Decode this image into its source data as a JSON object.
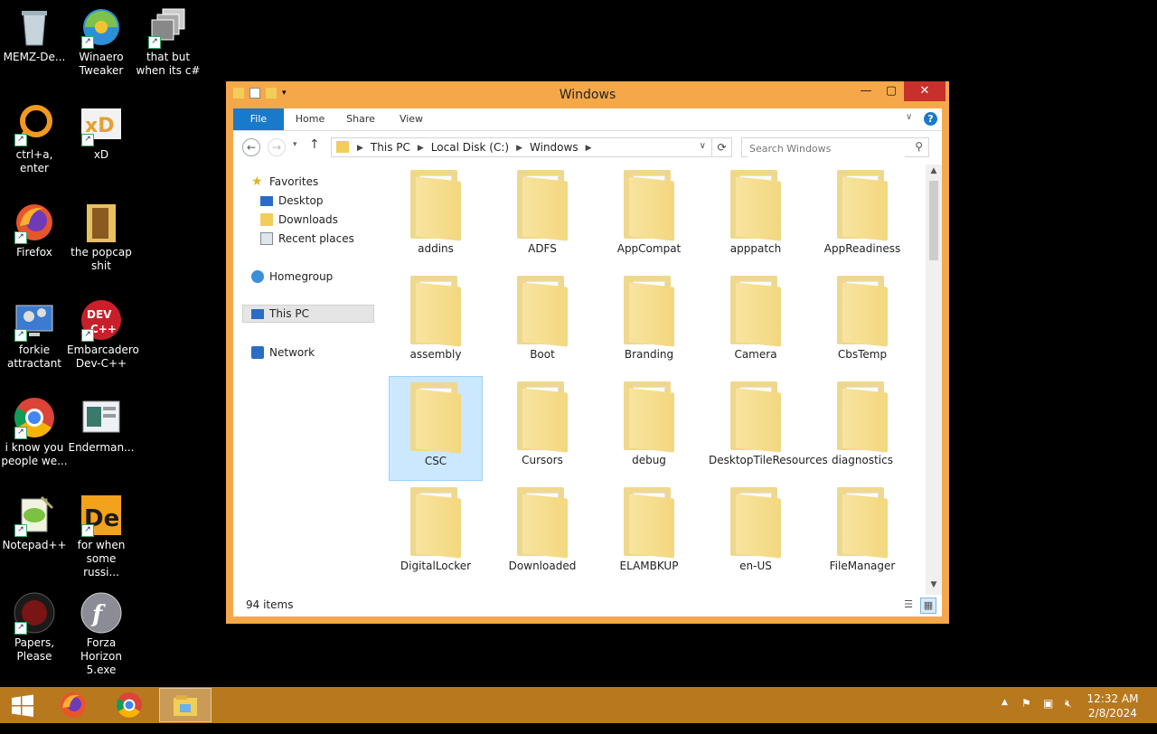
{
  "desktop": {
    "icons": [
      {
        "label": "MEMZ-De..."
      },
      {
        "label": "Winaero Tweaker"
      },
      {
        "label": "that but when its c#"
      },
      {
        "label": "ctrl+a, enter"
      },
      {
        "label": "xD"
      },
      {
        "label": "Firefox"
      },
      {
        "label": "the popcap shit"
      },
      {
        "label": "forkie attractant"
      },
      {
        "label": "Embarcadero Dev-C++"
      },
      {
        "label": "i know you people we..."
      },
      {
        "label": "Enderman..."
      },
      {
        "label": "Notepad++"
      },
      {
        "label": "for when some russi..."
      },
      {
        "label": "Papers, Please"
      },
      {
        "label": "Forza Horizon 5.exe"
      }
    ]
  },
  "window": {
    "title": "Windows",
    "ribbon": {
      "tabs": [
        "File",
        "Home",
        "Share",
        "View"
      ],
      "help": "?"
    },
    "address": {
      "crumbs": [
        "This PC",
        "Local Disk (C:)",
        "Windows"
      ]
    },
    "search": {
      "placeholder": "Search Windows"
    },
    "nav": {
      "favorites": "Favorites",
      "desktop": "Desktop",
      "downloads": "Downloads",
      "recent": "Recent places",
      "homegroup": "Homegroup",
      "thispc": "This PC",
      "network": "Network"
    },
    "folders": [
      "addins",
      "ADFS",
      "AppCompat",
      "apppatch",
      "AppReadiness",
      "assembly",
      "Boot",
      "Branding",
      "Camera",
      "CbsTemp",
      "CSC",
      "Cursors",
      "debug",
      "DesktopTileResources",
      "diagnostics",
      "DigitalLocker",
      "Downloaded",
      "ELAMBKUP",
      "en-US",
      "FileManager"
    ],
    "selected_folder": "CSC",
    "status": {
      "item_count": "94 items"
    }
  },
  "taskbar": {
    "clock_time": "12:32 AM",
    "clock_date": "2/8/2024"
  },
  "colors": {
    "window_frame": "#f5a84a",
    "taskbar": "#b8791e",
    "close_button": "#c7302b",
    "file_tab": "#1979ca",
    "selection": "#cce8ff"
  }
}
